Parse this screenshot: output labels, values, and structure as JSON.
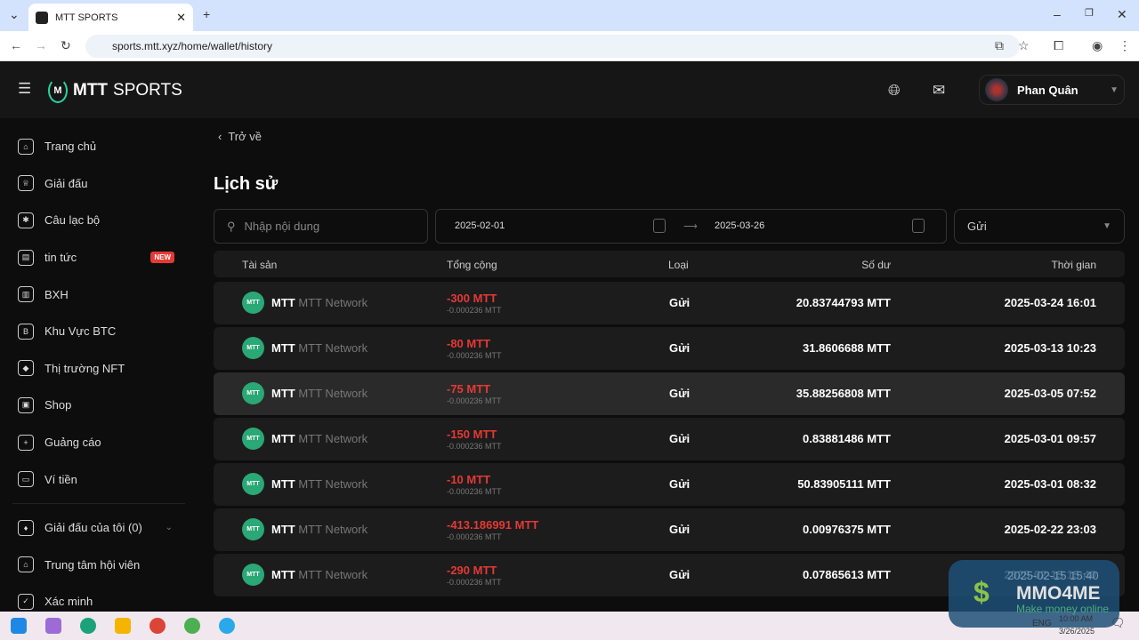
{
  "browser": {
    "tab_title": "MTT SPORTS",
    "url": "sports.mtt.xyz/home/wallet/history"
  },
  "header": {
    "logo_bold": "MTT",
    "logo_text": "SPORTS",
    "user_name": "Phan Quân"
  },
  "sidebar": {
    "items": [
      {
        "label": "Trang chủ",
        "icon": "home-icon"
      },
      {
        "label": "Giải đấu",
        "icon": "trophy-icon"
      },
      {
        "label": "Câu lạc bộ",
        "icon": "club-shield-icon"
      },
      {
        "label": "tin tức",
        "icon": "news-icon",
        "badge": "NEW"
      },
      {
        "label": "BXH",
        "icon": "ranking-icon"
      },
      {
        "label": "Khu Vực BTC",
        "icon": "bitcoin-icon"
      },
      {
        "label": "Thị trường NFT",
        "icon": "nft-icon"
      },
      {
        "label": "Shop",
        "icon": "shop-icon"
      },
      {
        "label": "Guảng cáo",
        "icon": "ads-icon"
      },
      {
        "label": "Ví tiền",
        "icon": "wallet-icon"
      }
    ],
    "items2": [
      {
        "label": "Giải đấu của tôi (0)",
        "icon": "cards-icon"
      },
      {
        "label": "Trung tâm hội viên",
        "icon": "member-icon"
      },
      {
        "label": "Xác minh",
        "icon": "verify-icon"
      }
    ]
  },
  "page": {
    "back": "Trở về",
    "title": "Lịch sử",
    "search_placeholder": "Nhập nội dung",
    "date_from": "2025-02-01",
    "date_to": "2025-03-26",
    "type_filter": "Gửi"
  },
  "table": {
    "headers": [
      "Tài sản",
      "Tổng cộng",
      "Loại",
      "Số dư",
      "Thời gian"
    ],
    "rows": [
      {
        "coin": "MTT",
        "network": "MTT Network",
        "amount": "-300 MTT",
        "fee": "-0.000236 MTT",
        "type": "Gửi",
        "balance": "20.83744793 MTT",
        "time": "2025-03-24 16:01"
      },
      {
        "coin": "MTT",
        "network": "MTT Network",
        "amount": "-80 MTT",
        "fee": "-0.000236 MTT",
        "type": "Gửi",
        "balance": "31.8606688 MTT",
        "time": "2025-03-13 10:23"
      },
      {
        "coin": "MTT",
        "network": "MTT Network",
        "amount": "-75 MTT",
        "fee": "-0.000236 MTT",
        "type": "Gửi",
        "balance": "35.88256808 MTT",
        "time": "2025-03-05 07:52"
      },
      {
        "coin": "MTT",
        "network": "MTT Network",
        "amount": "-150 MTT",
        "fee": "-0.000236 MTT",
        "type": "Gửi",
        "balance": "0.83881486 MTT",
        "time": "2025-03-01 09:57"
      },
      {
        "coin": "MTT",
        "network": "MTT Network",
        "amount": "-10 MTT",
        "fee": "-0.000236 MTT",
        "type": "Gửi",
        "balance": "50.83905111 MTT",
        "time": "2025-03-01 08:32"
      },
      {
        "coin": "MTT",
        "network": "MTT Network",
        "amount": "-413.186991 MTT",
        "fee": "-0.000236 MTT",
        "type": "Gửi",
        "balance": "0.00976375 MTT",
        "time": "2025-02-22 23:03"
      },
      {
        "coin": "MTT",
        "network": "MTT Network",
        "amount": "-290 MTT",
        "fee": "-0.000236 MTT",
        "type": "Gửi",
        "balance": "0.07865613 MTT",
        "time": "2025-02-15 15:40"
      }
    ]
  },
  "taskbar": {
    "lang": "ENG",
    "time": "10:00 AM",
    "date": "3/26/2025"
  },
  "watermark": {
    "brand": "MMO4ME",
    "tagline": "Make money online"
  }
}
